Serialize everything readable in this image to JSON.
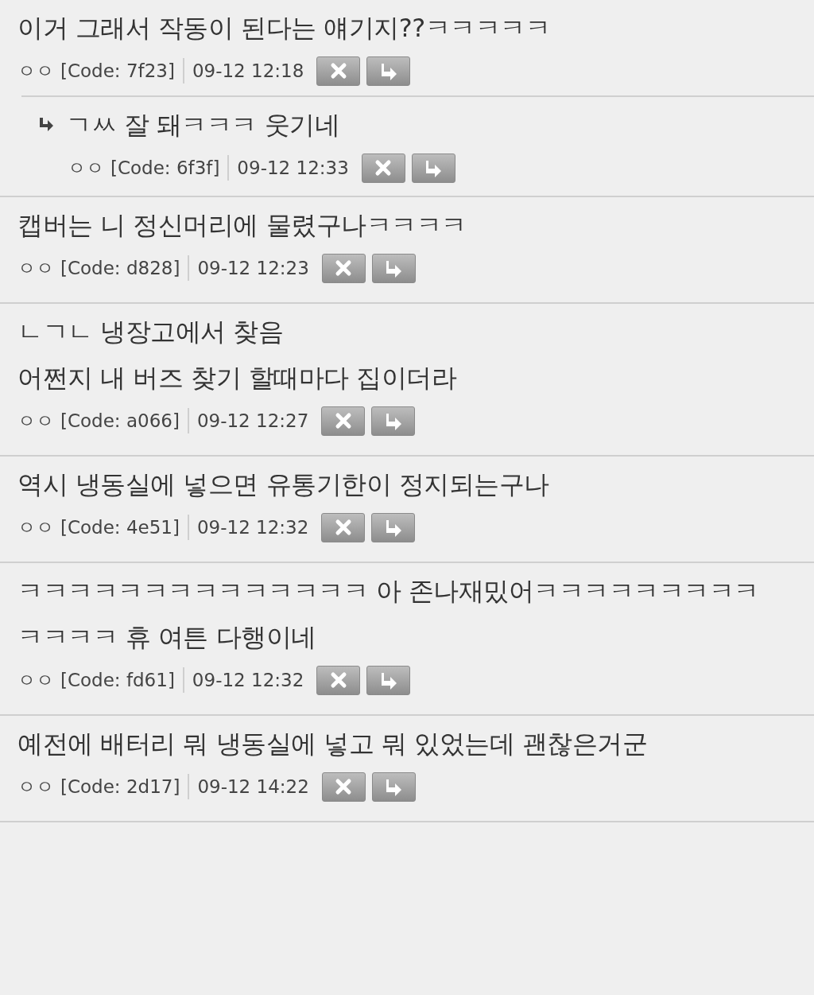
{
  "comments": [
    {
      "lines": [
        "이거 그래서 작동이 된다는 얘기지??ㅋㅋㅋㅋㅋ"
      ],
      "author": "ㅇㅇ",
      "code": "[Code: 7f23]",
      "time": "09-12 12:18",
      "replies": [
        {
          "lines": [
            "ㄱㅆ 잘 돼ㅋㅋㅋ 웃기네"
          ],
          "author": "ㅇㅇ",
          "code": "[Code: 6f3f]",
          "time": "09-12 12:33"
        }
      ]
    },
    {
      "lines": [
        "캡버는 니 정신머리에 물렸구나ㅋㅋㅋㅋ"
      ],
      "author": "ㅇㅇ",
      "code": "[Code: d828]",
      "time": "09-12 12:23"
    },
    {
      "lines": [
        "ㄴㄱㄴ 냉장고에서 찾음",
        "어쩐지 내 버즈 찾기 할때마다 집이더라"
      ],
      "author": "ㅇㅇ",
      "code": "[Code: a066]",
      "time": "09-12 12:27"
    },
    {
      "lines": [
        "역시 냉동실에 넣으면 유통기한이 정지되는구나"
      ],
      "author": "ㅇㅇ",
      "code": "[Code: 4e51]",
      "time": "09-12 12:32"
    },
    {
      "lines": [
        "ㅋㅋㅋㅋㅋㅋㅋㅋㅋㅋㅋㅋㅋㅋ 아 존나재밌어ㅋㅋㅋㅋㅋㅋㅋㅋㅋ",
        "ㅋㅋㅋㅋ 휴 여튼 다행이네"
      ],
      "author": "ㅇㅇ",
      "code": "[Code: fd61]",
      "time": "09-12 12:32"
    },
    {
      "lines": [
        "예전에 배터리 뭐 냉동실에 넣고 뭐 있었는데 괜찮은거군"
      ],
      "author": "ㅇㅇ",
      "code": "[Code: 2d17]",
      "time": "09-12 14:22"
    }
  ]
}
